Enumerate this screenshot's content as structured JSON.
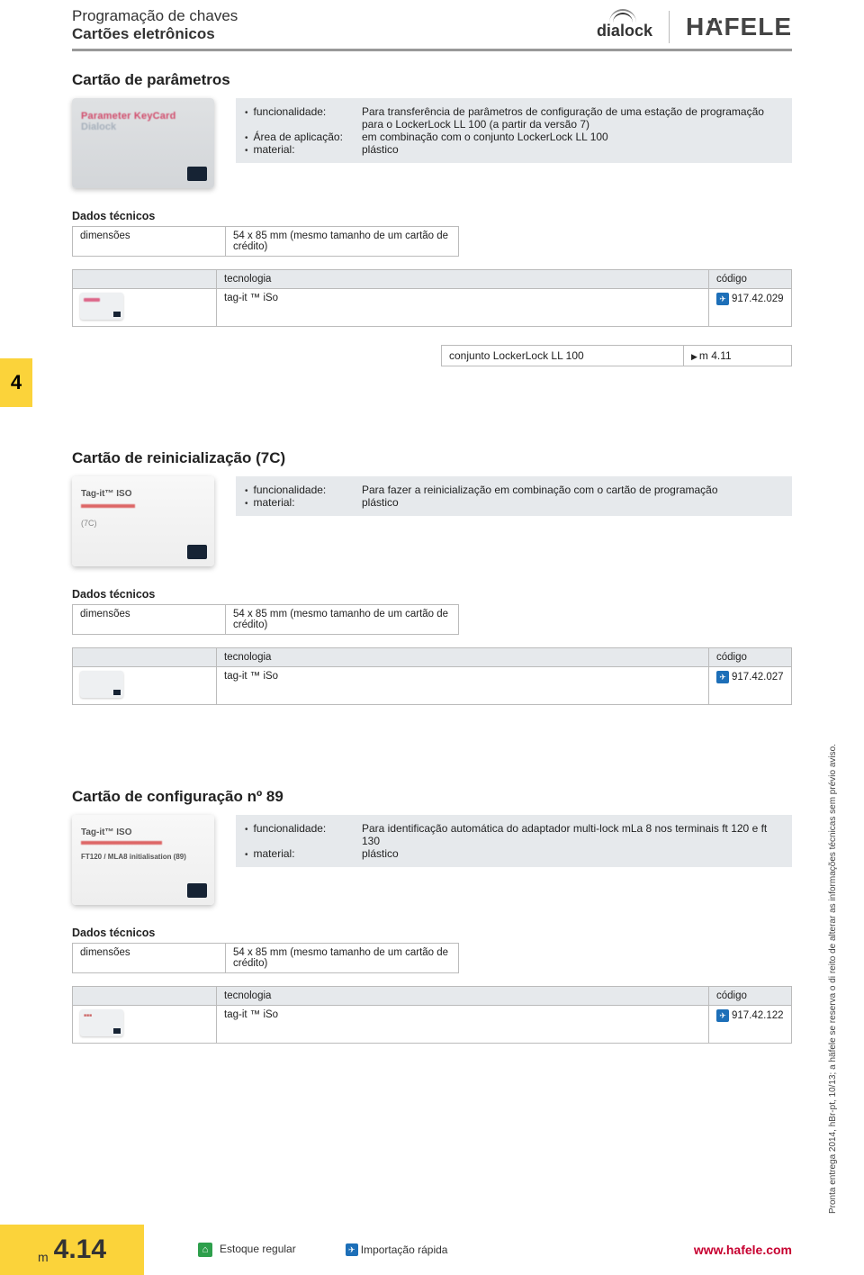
{
  "header": {
    "line1": "Programação de chaves",
    "line2": "Cartões eletrônicos",
    "brand_dialock": "dialock",
    "brand_hafele": "HAFELE"
  },
  "chapter_tab": "4",
  "sections": [
    {
      "title": "Cartão de parâmetros",
      "card": {
        "line1": "Parameter KeyCard",
        "line2": "Dialock"
      },
      "info": {
        "rows": [
          {
            "k": "funcionalidade:",
            "v": "Para transferência de parâmetros de configuração de uma estação de programação para o LockerLock LL 100 (a partir da versão 7)"
          },
          {
            "k": "Área de aplicação:",
            "v": "em combinação com o conjunto LockerLock LL 100"
          },
          {
            "k": "material:",
            "v": "plástico"
          }
        ]
      },
      "tech_title": "Dados técnicos",
      "tech_dim_label": "dimensões",
      "tech_dim_value": "54 x 85 mm (mesmo tamanho de um cartão de crédito)",
      "prod": {
        "h_tech": "tecnologia",
        "h_code": "código",
        "tech": "tag-it ™  iSo",
        "code": "917.42.029"
      },
      "xref": {
        "text": "conjunto LockerLock LL 100",
        "ref": "m 4.11"
      }
    },
    {
      "title": "Cartão de reinicialização (7C)",
      "card": {
        "line1": "Tag-it™ ISO",
        "line2": "(7C)"
      },
      "info": {
        "rows": [
          {
            "k": "funcionalidade:",
            "v": "Para fazer a reinicialização em combinação com o cartão de programação"
          },
          {
            "k": "material:",
            "v": "plástico"
          }
        ]
      },
      "tech_title": "Dados técnicos",
      "tech_dim_label": "dimensões",
      "tech_dim_value": "54 x 85 mm (mesmo tamanho de um cartão de crédito)",
      "prod": {
        "h_tech": "tecnologia",
        "h_code": "código",
        "tech": "tag-it ™  iSo",
        "code": "917.42.027"
      }
    },
    {
      "title": "Cartão de configuração nº 89",
      "card": {
        "line1": "Tag-it™ ISO",
        "line3": "FT120 / MLA8 initialisation (89)"
      },
      "info": {
        "rows": [
          {
            "k": "funcionalidade:",
            "v": "Para identificação automática do adaptador multi-lock mLa 8 nos terminais ft 120 e ft 130"
          },
          {
            "k": "material:",
            "v": "plástico"
          }
        ]
      },
      "tech_title": "Dados técnicos",
      "tech_dim_label": "dimensões",
      "tech_dim_value": "54 x 85 mm (mesmo tamanho de um cartão de crédito)",
      "prod": {
        "h_tech": "tecnologia",
        "h_code": "código",
        "tech": "tag-it ™  iSo",
        "code": "917.42.122"
      }
    }
  ],
  "side_copyright": "Pronta entrega 2014, hBr-pt, 10/13; a häfele se reserva o di    reito de alterar as informações técnicas sem prévio aviso.",
  "footer": {
    "page_m": "m",
    "page_num": "4.14",
    "legend_stock": "Estoque regular",
    "legend_import": "Importação rápida",
    "url": "www.hafele.com"
  }
}
